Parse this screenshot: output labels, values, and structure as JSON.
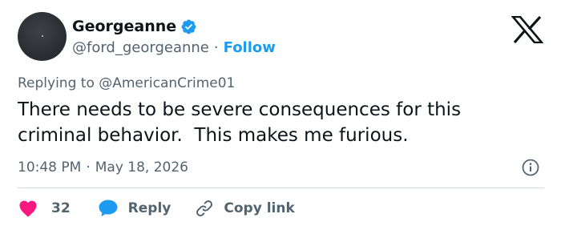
{
  "user": {
    "display_name": "Georgeanne",
    "handle": "@ford_georgeanne",
    "separator": "·",
    "follow_label": "Follow",
    "verified": true
  },
  "tweet": {
    "replying_to": "Replying to @AmericanCrime01",
    "text": "There needs to be severe consequences for this\ncriminal behavior.  This makes me furious.",
    "time": "10:48 PM",
    "date_separator": "·",
    "date": "May 18, 2026"
  },
  "actions": {
    "like_count": "32",
    "reply_label": "Reply",
    "copy_link_label": "Copy link"
  },
  "colors": {
    "accent": "#1d9bf0",
    "like": "#f91880",
    "secondary_text": "#536471",
    "primary_text": "#0f1419",
    "divider": "#cfd9de"
  },
  "icons": {
    "verified": "verified-badge-icon",
    "brand": "x-logo-icon",
    "info": "info-icon",
    "like": "heart-icon",
    "reply": "speech-bubble-icon",
    "copy": "link-icon"
  }
}
